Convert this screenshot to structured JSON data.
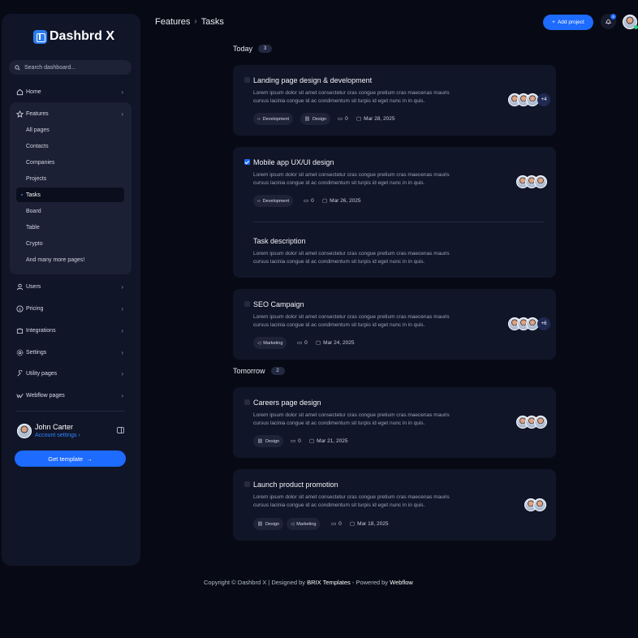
{
  "app": {
    "name": "Dashbrd X"
  },
  "search": {
    "placeholder": "Search dashboard..."
  },
  "nav": {
    "home": "Home",
    "features": "Features",
    "features_sub": [
      "All pages",
      "Contacts",
      "Companies",
      "Projects",
      "Tasks",
      "Board",
      "Table",
      "Crypto",
      "And many more pages!"
    ],
    "users": "Users",
    "pricing": "Pricing",
    "integrations": "Integrations",
    "settings": "Settings",
    "utility_pages": "Utility pages",
    "webflow_pages": "Webflow pages"
  },
  "user": {
    "name": "John Carter",
    "settings_link": "Account settings"
  },
  "sidebar_button": "Get template",
  "header": {
    "breadcrumb": [
      "Features",
      "Tasks"
    ],
    "add_project": "Add project",
    "notifications": "4"
  },
  "sections": {
    "today": {
      "label": "Today",
      "count": "3"
    },
    "tomorrow": {
      "label": "Tomorrow",
      "count": "2"
    }
  },
  "tasks": [
    {
      "title": "Landing page design & development",
      "description": "Lorem ipsum dolor sit amet consectetur cras congue pretium cras maecenas mauris cursus lacinia congue id ac condimentum sit turpis id eget nunc in in quis.",
      "tags": [
        "Development",
        "Design"
      ],
      "comments": "0",
      "date": "Mar 28, 2025",
      "more": "+4",
      "checked": false
    },
    {
      "title": "Mobile app UX/UI design",
      "description": "Lorem ipsum dolor sit amet consectetur cras congue pretium cras maecenas mauris cursus lacinia congue id ac condimentum sit turpis id eget nunc in in quis.",
      "tags": [
        "Development"
      ],
      "comments": "0",
      "date": "Mar 26, 2025",
      "checked": true,
      "subsection_title": "Task description",
      "subsection_text": "Lorem ipsum dolor sit amet consectetur cras congue pretium cras maecenas mauris cursus lacinia congue id ac condimentum sit turpis id eget nunc in in quis."
    },
    {
      "title": "SEO Campaign",
      "description": "Lorem ipsum dolor sit amet consectetur cras congue pretium cras maecenas mauris cursus lacinia congue id ac condimentum sit turpis id eget nunc in in quis.",
      "tags": [
        "Marketing"
      ],
      "comments": "0",
      "date": "Mar 24, 2025",
      "more": "+6",
      "checked": false
    },
    {
      "title": "Careers page design",
      "description": "Lorem ipsum dolor sit amet consectetur cras congue pretium cras maecenas mauris cursus lacinia congue id ac condimentum sit turpis id eget nunc in in quis.",
      "tags": [
        "Design"
      ],
      "comments": "0",
      "date": "Mar 21, 2025",
      "checked": false
    },
    {
      "title": "Launch product promotion",
      "description": "Lorem ipsum dolor sit amet consectetur cras congue pretium cras maecenas mauris cursus lacinia congue id ac condimentum sit turpis id eget nunc in in quis.",
      "tags": [
        "Design",
        "Marketing"
      ],
      "comments": "0",
      "date": "Mar 18, 2025",
      "checked": false
    }
  ],
  "footer": {
    "copyright": "Copyright © Dashbrd X | Designed by",
    "brix": "BRIX Templates",
    "powered": " - Powered by",
    "webflow": "Webflow"
  },
  "colors": {
    "accent": "#1d6bff",
    "background": "#070a14",
    "card": "#111528"
  }
}
